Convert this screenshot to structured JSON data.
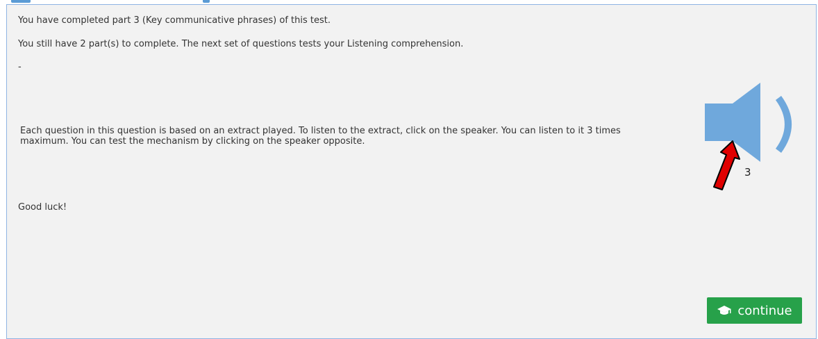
{
  "content": {
    "completed_line": "You have completed part 3 (Key communicative phrases) of this test.",
    "remaining_line": "You still have 2 part(s) to complete. The next set of questions tests your Listening comprehension.",
    "separator": "-",
    "instructions": "Each question in this question is based on an extract played. To listen to the extract, click on the speaker. You can listen to it 3 times maximum. You can test the mechanism by clicking on the speaker opposite.",
    "good_luck": "Good luck!"
  },
  "audio": {
    "icon": "speaker-icon",
    "plays_remaining": "3"
  },
  "annotation": {
    "icon": "red-arrow-icon"
  },
  "footer": {
    "continue_label": "continue",
    "continue_icon": "graduation-cap-icon"
  },
  "colors": {
    "panel_bg": "#f2f2f2",
    "panel_border": "#8eb4e3",
    "speaker": "#6fa8dc",
    "arrow": "#ff0000",
    "button": "#27a14a"
  }
}
